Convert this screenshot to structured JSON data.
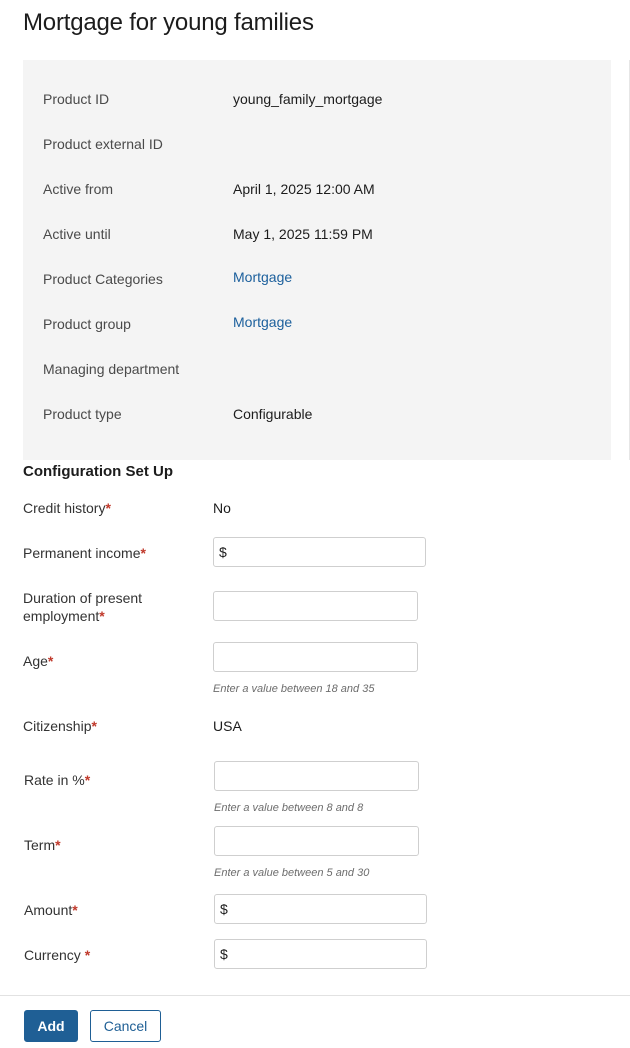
{
  "page": {
    "title": "Mortgage for young families"
  },
  "product_info": [
    {
      "label": "Product ID",
      "value": "young_family_mortgage",
      "is_link": false
    },
    {
      "label": "Product external ID",
      "value": "",
      "is_link": false
    },
    {
      "label": "Active from",
      "value": "April 1, 2025 12:00 AM",
      "is_link": false
    },
    {
      "label": "Active until",
      "value": "May 1, 2025 11:59 PM",
      "is_link": false
    },
    {
      "label": "Product Categories",
      "value": "Mortgage",
      "is_link": true
    },
    {
      "label": "Product group",
      "value": "Mortgage",
      "is_link": true
    },
    {
      "label": "Managing department",
      "value": "",
      "is_link": false
    },
    {
      "label": "Product type",
      "value": "Configurable",
      "is_link": false
    }
  ],
  "config": {
    "title": "Configuration Set Up",
    "required_mark": "*",
    "fields": {
      "credit_history": {
        "label": "Credit history",
        "value": "No"
      },
      "permanent_income": {
        "label": "Permanent income",
        "value": "$"
      },
      "duration_employment": {
        "label": "Duration of present employment",
        "value": ""
      },
      "age": {
        "label": "Age",
        "value": "",
        "hint": "Enter a value between 18 and 35"
      },
      "citizenship": {
        "label": "Citizenship",
        "value": "USA"
      },
      "rate": {
        "label": "Rate in %",
        "value": "",
        "hint": "Enter a value between 8 and 8"
      },
      "term": {
        "label": "Term",
        "value": "",
        "hint": "Enter a value between 5 and 30"
      },
      "amount": {
        "label": "Amount",
        "value": "$"
      },
      "currency": {
        "label": "Currency ",
        "value": "$"
      }
    }
  },
  "footer": {
    "add_label": "Add",
    "cancel_label": "Cancel"
  },
  "colors": {
    "link": "#1b5f9c",
    "primary_button": "#1f5f95",
    "required": "#c0392b",
    "panel_bg": "#f4f4f4"
  }
}
